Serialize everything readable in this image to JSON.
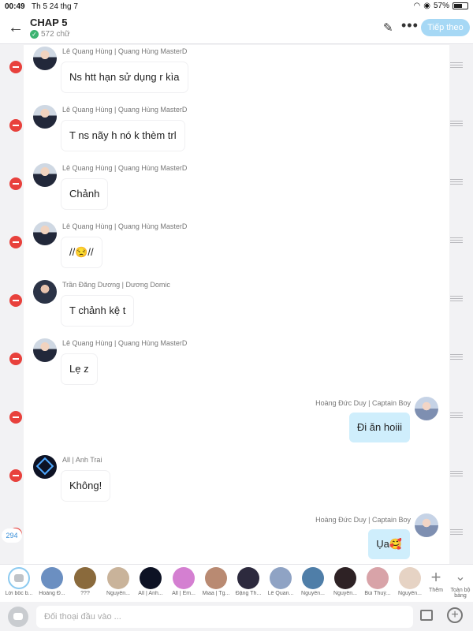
{
  "status": {
    "time": "00:49",
    "date": "Th 5 24 thg 7",
    "battery": "57%"
  },
  "header": {
    "title": "CHAP 5",
    "subtitle": "572 chữ",
    "next_label": "Tiếp theo"
  },
  "messages": [
    {
      "sender": "Lê Quang Hùng | Quang Hùng MasterD",
      "text": "Ns htt hạn sử dụng r kìa",
      "side": "left",
      "avatar": "hung"
    },
    {
      "sender": "Lê Quang Hùng | Quang Hùng MasterD",
      "text": "T ns nãy h nó k thèm trl",
      "side": "left",
      "avatar": "hung"
    },
    {
      "sender": "Lê Quang Hùng | Quang Hùng MasterD",
      "text": "Chảnh",
      "side": "left",
      "avatar": "hung"
    },
    {
      "sender": "Lê Quang Hùng | Quang Hùng MasterD",
      "text": "//😒//",
      "side": "left",
      "avatar": "hung"
    },
    {
      "sender": "Trần Đăng Dương | Dương Domic",
      "text": "T chảnh kệ t",
      "side": "left",
      "avatar": "duong"
    },
    {
      "sender": "Lê Quang Hùng | Quang Hùng MasterD",
      "text": "Lẹ z",
      "side": "left",
      "avatar": "hung"
    },
    {
      "sender": "Hoàng Đức Duy | Captain Boy",
      "text": "Đi ăn hoiii",
      "side": "right",
      "avatar": "duy"
    },
    {
      "sender": "All | Anh Trai",
      "text": "Không!",
      "side": "left",
      "avatar": "all"
    },
    {
      "sender": "Hoàng Đức Duy | Captain Boy",
      "text": "Ụa🥰",
      "side": "right",
      "avatar": "duy"
    }
  ],
  "counter": "294",
  "characters": [
    {
      "label": "Lời bốc b...",
      "color": "#ffffff"
    },
    {
      "label": "Hoàng Đ...",
      "color": "#6b8fc1"
    },
    {
      "label": "???",
      "color": "#8a6a3c"
    },
    {
      "label": "Nguyễn...",
      "color": "#c9b39a"
    },
    {
      "label": "All | Anh...",
      "color": "#0d1224"
    },
    {
      "label": "All | Em...",
      "color": "#d47fd1"
    },
    {
      "label": "Miaa | Tg...",
      "color": "#b98a72"
    },
    {
      "label": "Đặng Th...",
      "color": "#2d2a3e"
    },
    {
      "label": "Lê Quan...",
      "color": "#8fa3c4"
    },
    {
      "label": "Nguyễn...",
      "color": "#4f7ea8"
    },
    {
      "label": "Nguyễn...",
      "color": "#2e2225"
    },
    {
      "label": "Bùi Thuý...",
      "color": "#d8a3a8"
    },
    {
      "label": "Nguyễn...",
      "color": "#e6d3c4"
    }
  ],
  "add_label": "Thêm",
  "all_label": "Toàn bộ bảng",
  "input": {
    "placeholder": "Đối thoại đầu vào ..."
  }
}
